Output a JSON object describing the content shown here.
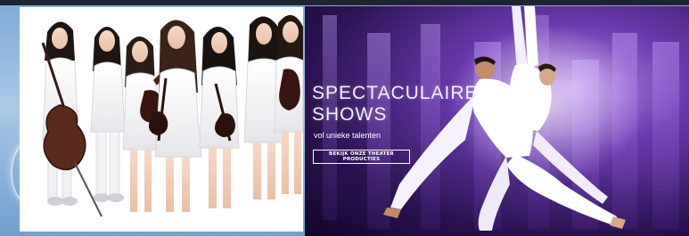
{
  "hero": {
    "title_line1": "SPECTACULAIRE",
    "title_line2": "SHOWS",
    "subtitle": "vol unieke talenten",
    "cta_label": "BEKIJK ONZE THEATER PRODUCTIES"
  },
  "left_promo": {
    "image": "violin-ensemble-photo",
    "performer_count": 7
  },
  "colors": {
    "hero_purple": "#6a39ad",
    "hero_dark": "#12062a",
    "page_blue": "#8fb6d8",
    "text_white": "#ffffff"
  }
}
